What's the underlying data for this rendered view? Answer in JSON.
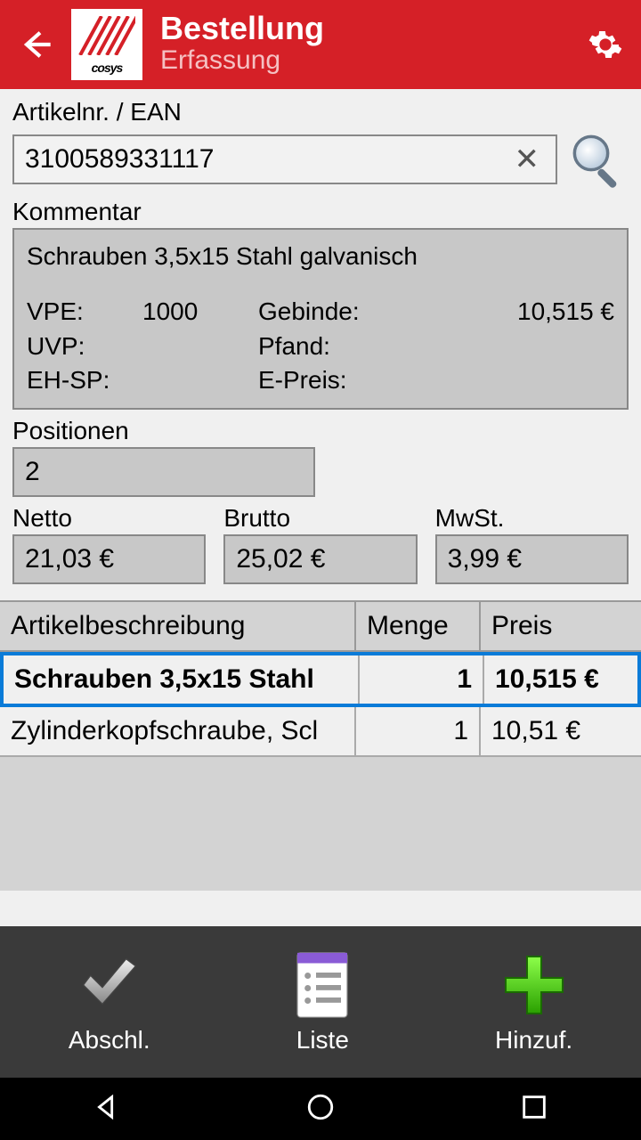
{
  "header": {
    "title": "Bestellung",
    "subtitle": "Erfassung",
    "logo_text": "cosys"
  },
  "article": {
    "label": "Artikelnr. / EAN",
    "value": "3100589331117"
  },
  "comment": {
    "label": "Kommentar",
    "description": "Schrauben 3,5x15 Stahl galvanisch",
    "vpe_label": "VPE:",
    "vpe_value": "1000",
    "gebinde_label": "Gebinde:",
    "gebinde_value": "10,515 €",
    "uvp_label": "UVP:",
    "uvp_value": "",
    "pfand_label": "Pfand:",
    "pfand_value": "",
    "ehsp_label": "EH-SP:",
    "ehsp_value": "",
    "epreis_label": "E-Preis:",
    "epreis_value": ""
  },
  "positions": {
    "label": "Positionen",
    "value": "2"
  },
  "totals": {
    "netto_label": "Netto",
    "netto_value": "21,03 €",
    "brutto_label": "Brutto",
    "brutto_value": "25,02 €",
    "mwst_label": "MwSt.",
    "mwst_value": "3,99 €"
  },
  "table": {
    "headers": {
      "desc": "Artikelbeschreibung",
      "qty": "Menge",
      "price": "Preis"
    },
    "rows": [
      {
        "desc": "Schrauben 3,5x15 Stahl",
        "qty": "1",
        "price": "10,515 €",
        "selected": true
      },
      {
        "desc": "Zylinderkopfschraube, Scl",
        "qty": "1",
        "price": "10,51 €",
        "selected": false
      }
    ]
  },
  "toolbar": {
    "abschl": "Abschl.",
    "liste": "Liste",
    "hinzuf": "Hinzuf."
  }
}
